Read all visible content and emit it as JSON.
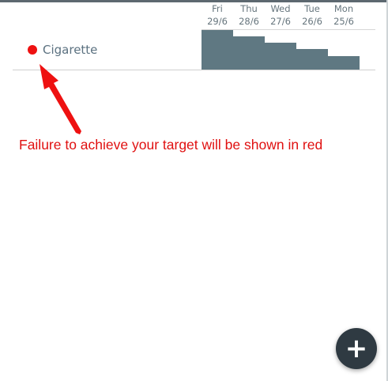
{
  "days": [
    {
      "weekday": "Fri",
      "date": "29/6",
      "value": 1.0
    },
    {
      "weekday": "Thu",
      "date": "28/6",
      "value": 0.84
    },
    {
      "weekday": "Wed",
      "date": "27/6",
      "value": 0.68
    },
    {
      "weekday": "Tue",
      "date": "26/6",
      "value": 0.52
    },
    {
      "weekday": "Mon",
      "date": "25/6",
      "value": 0.34
    }
  ],
  "habit": {
    "name": "Cigarette",
    "status_color": "#ee1111",
    "bar_color": "#5f7882"
  },
  "annotation": {
    "text": "Failure to achieve your target will be shown in red",
    "color": "#e01010"
  },
  "fab": {
    "icon": "plus-icon",
    "symbol": "+"
  }
}
